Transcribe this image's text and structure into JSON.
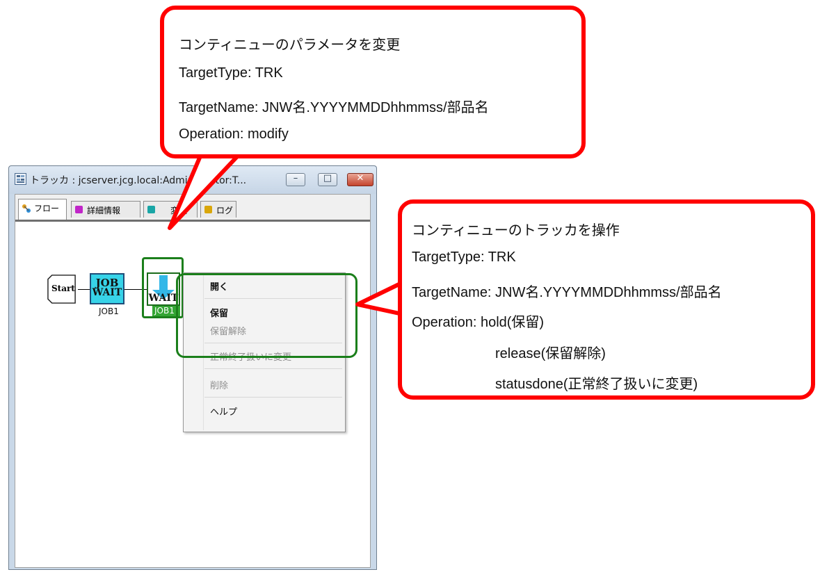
{
  "window": {
    "title": "トラッカ : jcserver.jcg.local:Administrator:T...",
    "min_glyph": "–",
    "max_glyph": "□",
    "close_glyph": "✕"
  },
  "tabs": [
    {
      "label": "フロー",
      "icon": "flow-icon"
    },
    {
      "label": "詳細情報",
      "icon": "detail-icon",
      "color": "#c026c8"
    },
    {
      "label": "変数",
      "icon": "variable-icon",
      "color": "#1aa6a6"
    },
    {
      "label": "ログ",
      "icon": "log-icon",
      "color": "#d9a60a"
    }
  ],
  "flow": {
    "start_label": "Start",
    "job1": {
      "text_top": "JOB",
      "text_bottom": "WAIT",
      "caption": "JOB1"
    },
    "job2": {
      "text": "WAIT",
      "caption": "JOB1"
    }
  },
  "context_menu": {
    "open": "開く",
    "hold": "保留",
    "release": "保留解除",
    "statusdone": "正常終了扱いに変更",
    "delete": "削除",
    "help": "ヘルプ"
  },
  "callout_top": {
    "line1": "コンティニューのパラメータを変更",
    "line2": "TargetType: TRK",
    "line3": "TargetName: JNW名.YYYYMMDDhhmmss/部品名",
    "line4": "Operation: modify"
  },
  "callout_right": {
    "line1": "コンティニューのトラッカを操作",
    "line2": "TargetType: TRK",
    "line3": "TargetName: JNW名.YYYYMMDDhhmmss/部品名",
    "line4": "Operation: hold(保留)",
    "line5": "release(保留解除)",
    "line6": "statusdone(正常終了扱いに変更)"
  },
  "colors": {
    "callout_border": "#ff0000",
    "selection_green": "#1b7f1b",
    "job_fill": "#37d3e8"
  }
}
